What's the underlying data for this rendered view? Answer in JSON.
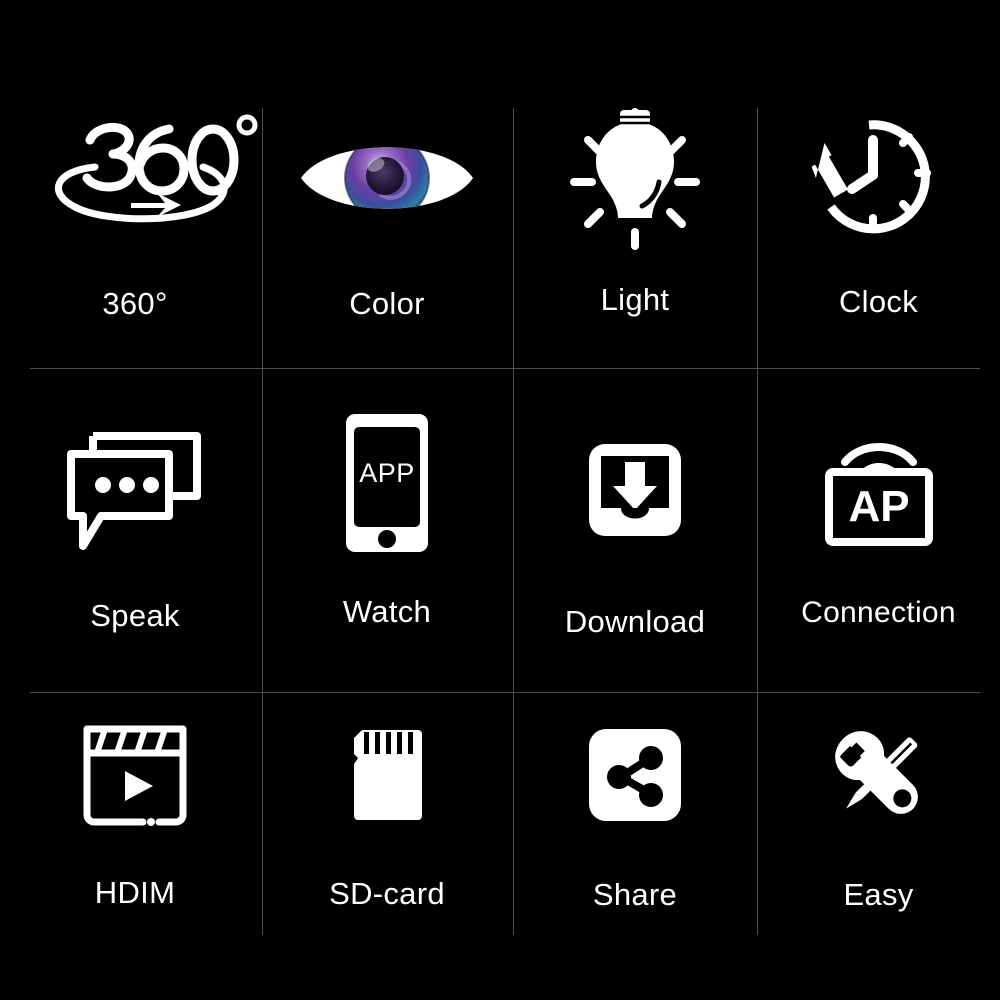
{
  "page": {
    "background_color": "#000000",
    "foreground_color": "#ffffff",
    "divider_color": "#4e4e4e",
    "accent_iris_colors": [
      "#7b3fa0",
      "#4b2f8f",
      "#2b7fa8",
      "#1f5f8b",
      "#c8a8e0"
    ]
  },
  "grid": {
    "rows": 3,
    "columns": 4
  },
  "features": [
    {
      "id": "rotation-360",
      "label": "360°",
      "icon": "rotation-360-icon"
    },
    {
      "id": "color",
      "label": "Color",
      "icon": "eye-color-icon"
    },
    {
      "id": "light",
      "label": "Light",
      "icon": "lightbulb-icon"
    },
    {
      "id": "clock",
      "label": "Clock",
      "icon": "clock-rewind-icon"
    },
    {
      "id": "speak",
      "label": "Speak",
      "icon": "chat-bubbles-icon"
    },
    {
      "id": "watch",
      "label": "Watch",
      "icon": "phone-app-icon",
      "screen_text": "APP"
    },
    {
      "id": "download",
      "label": "Download",
      "icon": "download-arrow-icon"
    },
    {
      "id": "connection",
      "label": "Connection",
      "icon": "ap-wifi-icon",
      "box_text": "AP"
    },
    {
      "id": "hdim",
      "label": "HDIM",
      "icon": "clapperboard-play-icon"
    },
    {
      "id": "sd-card",
      "label": "SD-card",
      "icon": "sd-card-icon"
    },
    {
      "id": "share",
      "label": "Share",
      "icon": "share-nodes-icon"
    },
    {
      "id": "easy",
      "label": "Easy",
      "icon": "wrench-screwdriver-icon"
    }
  ]
}
